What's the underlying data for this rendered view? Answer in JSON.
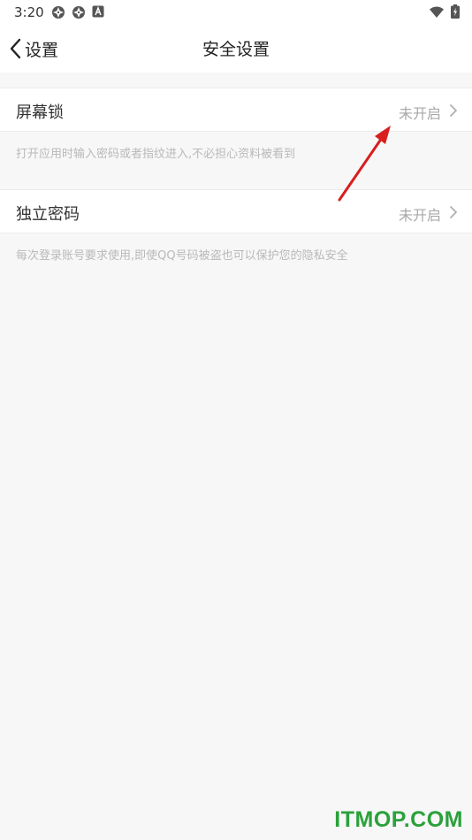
{
  "status_bar": {
    "time": "3:20"
  },
  "nav": {
    "back_label": "设置",
    "title": "安全设置"
  },
  "settings": {
    "screen_lock": {
      "label": "屏幕锁",
      "status": "未开启",
      "description": "打开应用时输入密码或者指纹进入,不必担心资料被看到"
    },
    "independent_password": {
      "label": "独立密码",
      "status": "未开启",
      "description": "每次登录账号要求使用,即使QQ号码被盗也可以保护您的隐私安全"
    }
  },
  "watermark": "ITMOP.COM",
  "colors": {
    "annotation_arrow": "#d81e1e",
    "watermark": "#2aa13a"
  }
}
